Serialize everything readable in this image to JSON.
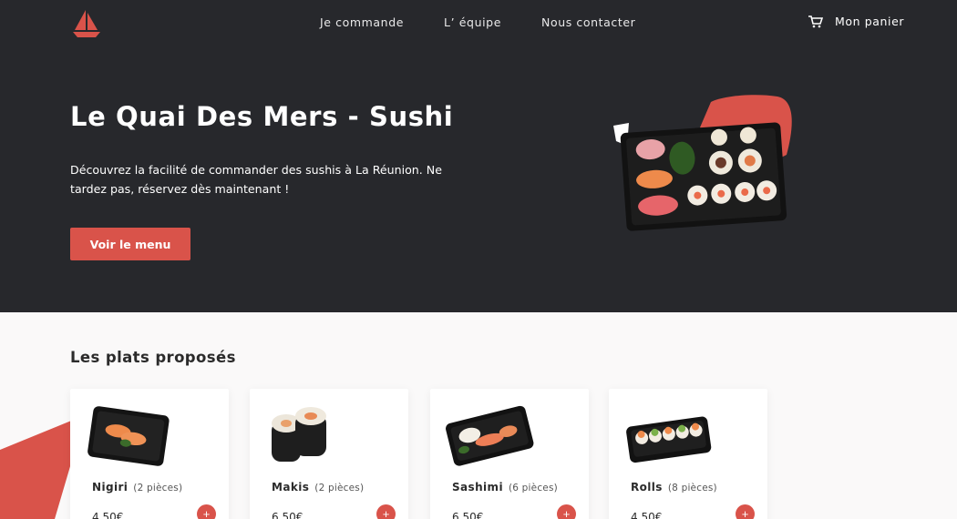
{
  "brand": {
    "logo_icon": "sailboat-icon",
    "accent": "#d9534a",
    "dark": "#27282c"
  },
  "nav": {
    "items": [
      {
        "label": "Je commande"
      },
      {
        "label": "L’ équipe"
      },
      {
        "label": "Nous contacter"
      }
    ],
    "cart_label": "Mon panier",
    "cart_icon": "cart-icon"
  },
  "hero": {
    "title": "Le Quai Des Mers - Sushi",
    "text": "Découvrez la facilité de commander des sushis à La Réunion. Ne tardez pas, réservez dès maintenant !",
    "cta_label": "Voir le menu"
  },
  "menu": {
    "title": "Les plats proposés",
    "items": [
      {
        "name": "Nigiri",
        "pieces": "(2 pièces)",
        "price": "4.50€",
        "add_label": "+"
      },
      {
        "name": "Makis",
        "pieces": "(2 pièces)",
        "price": "6.50€",
        "add_label": "+"
      },
      {
        "name": "Sashimi",
        "pieces": "(6 pièces)",
        "price": "6.50€",
        "add_label": "+"
      },
      {
        "name": "Rolls",
        "pieces": "(8 pièces)",
        "price": "4.50€",
        "add_label": "+"
      }
    ]
  }
}
